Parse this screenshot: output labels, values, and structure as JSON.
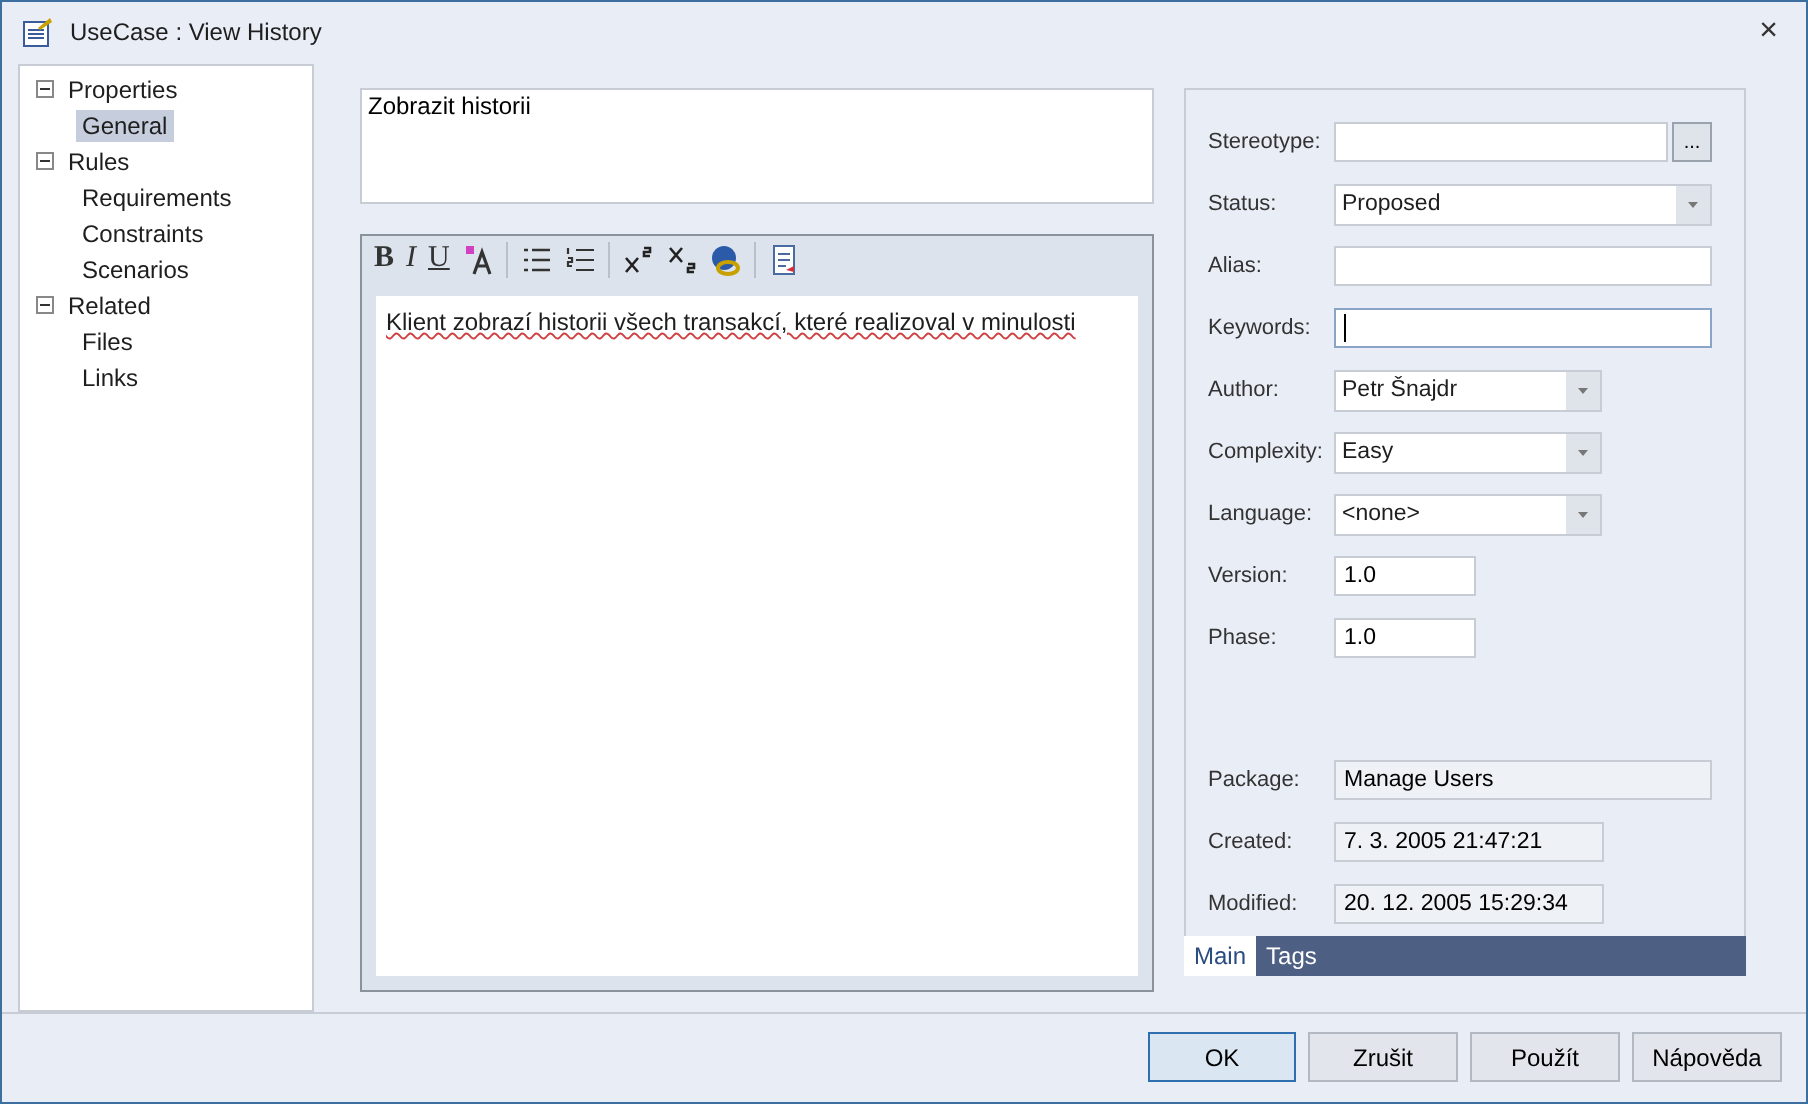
{
  "window": {
    "title": "UseCase : View History",
    "close": "×"
  },
  "tree": [
    {
      "label": "Properties",
      "expanded": true,
      "selected": false,
      "children": [
        {
          "label": "General",
          "selected": true
        }
      ]
    },
    {
      "label": "Rules",
      "expanded": true,
      "selected": false,
      "children": [
        {
          "label": "Requirements",
          "selected": false
        },
        {
          "label": "Constraints",
          "selected": false
        },
        {
          "label": "Scenarios",
          "selected": false
        }
      ]
    },
    {
      "label": "Related",
      "expanded": true,
      "selected": false,
      "children": [
        {
          "label": "Files",
          "selected": false
        },
        {
          "label": "Links",
          "selected": false
        }
      ]
    }
  ],
  "name_field": {
    "value": "Zobrazit historii"
  },
  "notes": {
    "toolbar": [
      "B",
      "I",
      "U"
    ],
    "text": "Klient zobrazí historii všech transakcí, které realizoval v minulosti"
  },
  "form": [
    {
      "label": "Stereotype:",
      "kind": "picker",
      "button": "..."
    },
    {
      "label": "Status:",
      "kind": "combo-wide",
      "value": "Proposed"
    },
    {
      "label": "Alias:",
      "kind": "text",
      "focused": false
    },
    {
      "label": "Keywords:",
      "kind": "text",
      "focused": true
    },
    {
      "label": "Author:",
      "kind": "combo",
      "value": "Petr Šnajdr"
    },
    {
      "label": "Complexity:",
      "kind": "combo",
      "value": "Easy"
    },
    {
      "label": "Language:",
      "kind": "combo",
      "value": "<none>"
    },
    {
      "label": "Version:",
      "kind": "short",
      "value": "1.0"
    },
    {
      "label": "Phase:",
      "kind": "short",
      "value": "1.0"
    }
  ],
  "info": [
    {
      "label": "Package:",
      "kind": "wide",
      "value": "Manage Users"
    },
    {
      "label": "Created:",
      "kind": "medium",
      "value": "7. 3. 2005 21:47:21"
    },
    {
      "label": "Modified:",
      "kind": "medium",
      "value": "20. 12. 2005 15:29:34"
    }
  ],
  "tabs": [
    {
      "label": "Main",
      "selected": true
    },
    {
      "label": "Tags",
      "selected": false
    }
  ],
  "buttons": [
    {
      "label": "OK",
      "default": true
    },
    {
      "label": "Zrušit",
      "default": false
    },
    {
      "label": "Použít",
      "default": false
    },
    {
      "label": "Nápověda",
      "default": false
    }
  ]
}
